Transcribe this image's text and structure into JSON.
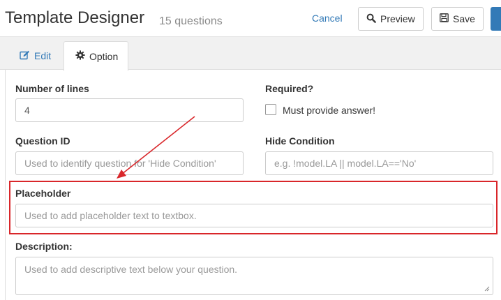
{
  "header": {
    "title": "Template Designer",
    "subtitle": "15 questions",
    "cancel_label": "Cancel",
    "preview_label": "Preview",
    "save_label": "Save"
  },
  "tabs": [
    {
      "label": "Edit",
      "icon": "edit-icon",
      "active": false
    },
    {
      "label": "Option",
      "icon": "gear-icon",
      "active": true
    }
  ],
  "form": {
    "lines": {
      "label": "Number of lines",
      "value": "4"
    },
    "required": {
      "label": "Required?",
      "checkbox_label": "Must provide answer!",
      "checked": false
    },
    "question_id": {
      "label": "Question ID",
      "placeholder": "Used to identify question for 'Hide Condition'"
    },
    "hide_condition": {
      "label": "Hide Condition",
      "placeholder": "e.g. !model.LA || model.LA=='No'"
    },
    "placeholder": {
      "label": "Placeholder",
      "placeholder": "Used to add placeholder text to textbox."
    },
    "description": {
      "label": "Description:",
      "placeholder": "Used to add descriptive text below your question."
    }
  },
  "colors": {
    "accent": "#337ab7",
    "annotation": "#d9262a"
  }
}
